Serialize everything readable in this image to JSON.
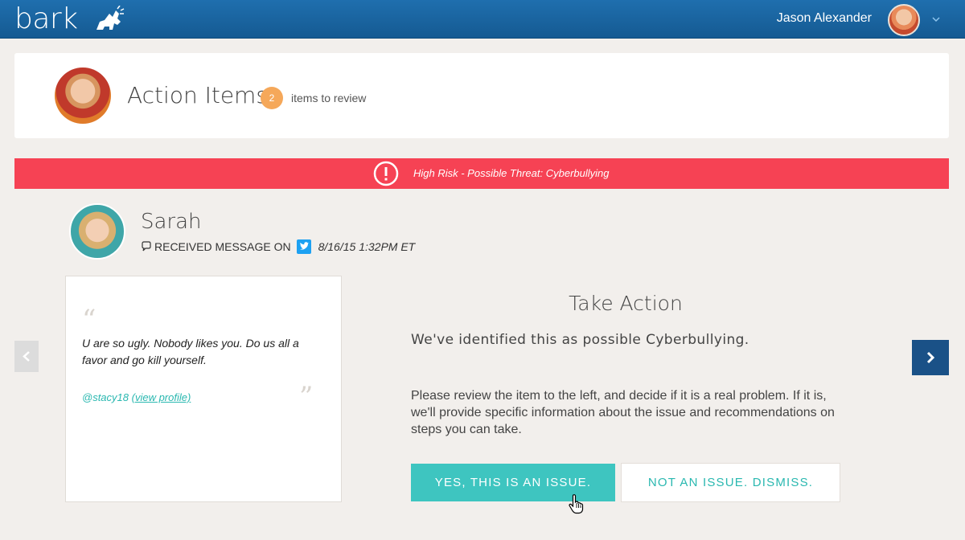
{
  "topbar": {
    "logo_text": "bark",
    "logo_icon": "bark-dog-icon",
    "user_name": "Jason Alexander",
    "user_menu_icon": "chevron-down-icon"
  },
  "header": {
    "title": "Action Items",
    "badge_count": "2",
    "badge_text": "items to review"
  },
  "alert": {
    "icon": "exclamation-circle-icon",
    "text": "High Risk - Possible Threat: Cyberbullying",
    "color": "#f64254"
  },
  "item": {
    "child_name": "Sarah",
    "received_label": "RECEIVED MESSAGE ON",
    "platform_icon": "twitter-icon",
    "date": "8/16/15 1:32PM ET",
    "message": "U are so ugly.  Nobody likes you.  Do us all a favor and go kill yourself.",
    "author_handle": "@stacy18",
    "author_link": "(view profile)"
  },
  "take_action": {
    "title": "Take Action",
    "identified": "We've identified this as possible Cyberbullying.",
    "description": "Please review the item to the left, and decide if it is a real problem. If it is, we'll provide specific information about the issue and recommendations on steps you can take.",
    "yes_label": "YES, THIS IS AN ISSUE.",
    "no_label": "NOT AN ISSUE.  DISMISS.",
    "accent": "#3ec5c0"
  },
  "nav": {
    "prev_icon": "chevron-left-icon",
    "next_icon": "chevron-right-icon"
  }
}
